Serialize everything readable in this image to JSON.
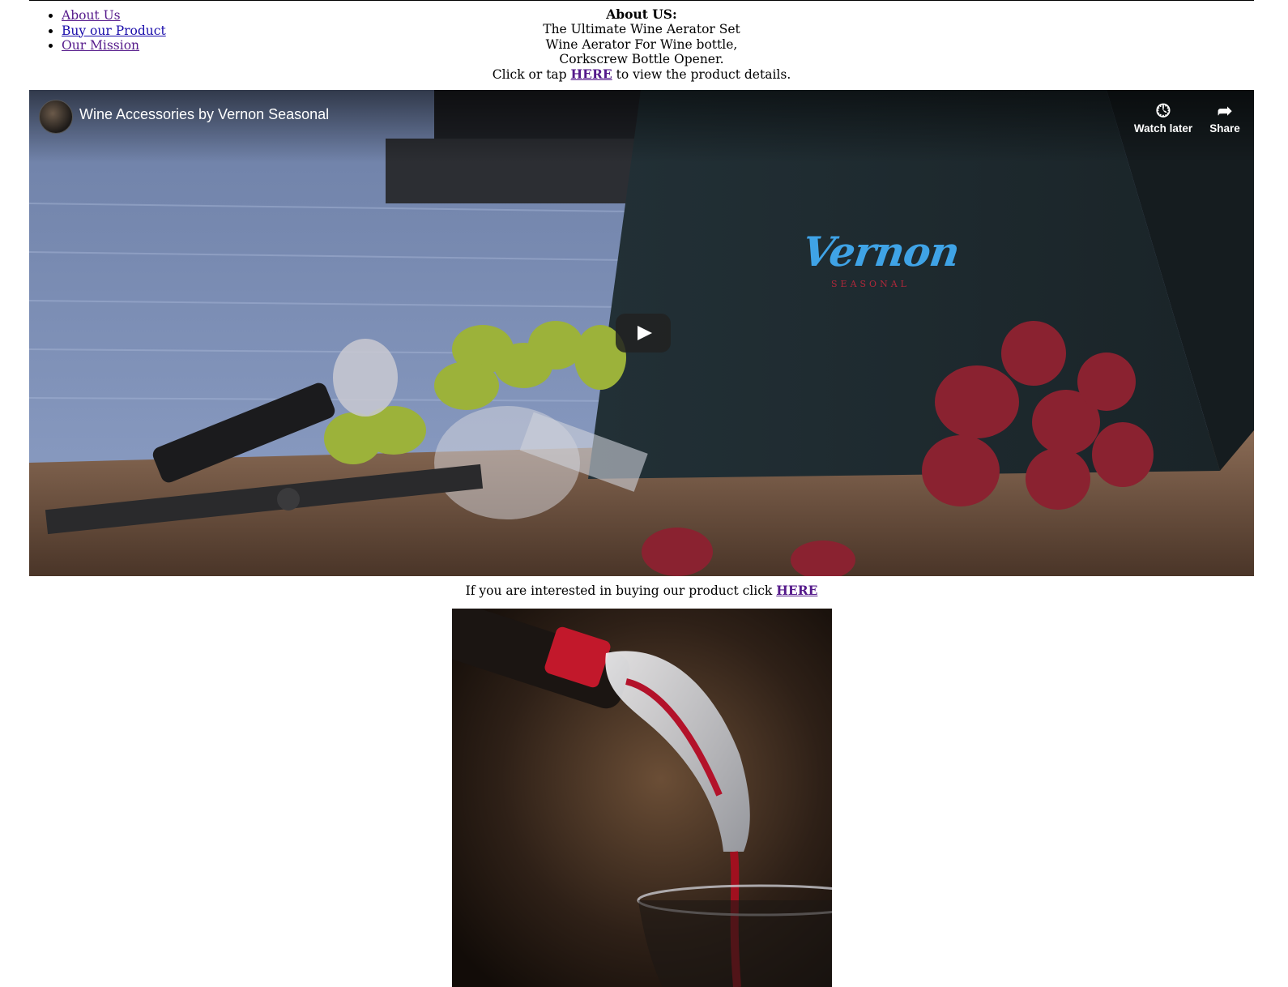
{
  "nav": {
    "items": [
      {
        "label": "About Us"
      },
      {
        "label": "Buy our Product"
      },
      {
        "label": "Our Mission"
      }
    ]
  },
  "about": {
    "heading": "About US:",
    "lines": [
      "The Ultimate Wine Aerator Set",
      "Wine Aerator For Wine bottle,",
      "Corkscrew Bottle Opener."
    ],
    "cta_prefix": "Click or tap ",
    "cta_link": "HERE",
    "cta_suffix": " to view the product details."
  },
  "video": {
    "title": "Wine Accessories by Vernon Seasonal",
    "watch_later_label": "Watch later",
    "share_label": "Share",
    "watch_later_icon": "clock-icon",
    "share_icon": "share-arrow-icon",
    "logo_text": "Vernon",
    "logo_sub": "SEASONAL"
  },
  "buy": {
    "prefix": "If you are interested in buying our product click ",
    "link": "HERE"
  },
  "colors": {
    "link_unvisited": "#1a0dab",
    "link_visited": "#551a8b"
  }
}
